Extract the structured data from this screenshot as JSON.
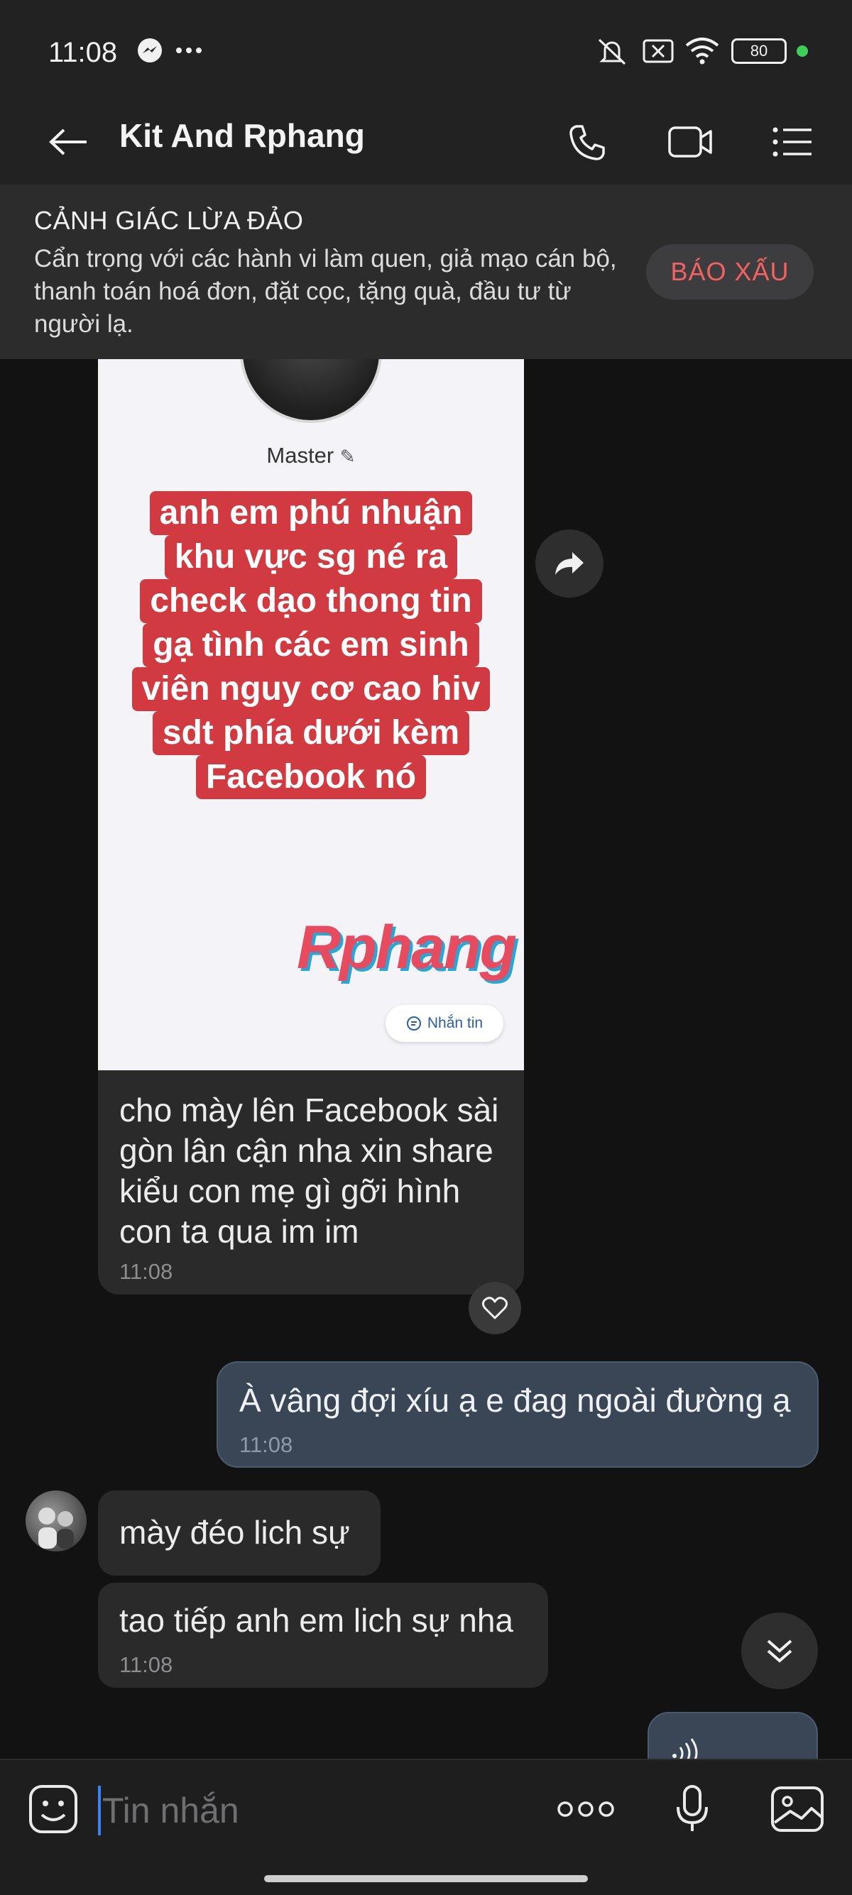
{
  "status_bar": {
    "time": "11:08",
    "battery": "80"
  },
  "header": {
    "title": "Kit And Rphang"
  },
  "warning": {
    "title": "CẢNH GIÁC LỪA ĐẢO",
    "body": "Cẩn trọng với các hành vi làm quen, giả mạo cán bộ, thanh toán hoá đơn, đặt cọc, tặng quà, đầu tư từ người lạ.",
    "report_label": "BÁO XẤU"
  },
  "messages": {
    "image_card": {
      "profile_name": "Master",
      "red_text": [
        "anh em phú nhuận",
        "khu vực sg né ra",
        "check dạo thong tin",
        "gạ tình các em sinh",
        "viên nguy cơ cao hiv",
        "sdt phía dưới kèm",
        "Facebook nó"
      ],
      "watermark": "Rphang",
      "message_pill": "Nhắn tin",
      "caption": "cho mày lên Facebook sài gòn lân cận nha xin share kiểu con mẹ gì gỡi hình con ta qua im im",
      "time": "11:08"
    },
    "sent": {
      "text": "À vâng đợi xíu ạ e đag ngoài đường ạ",
      "time": "11:08"
    },
    "received_1": {
      "text": "mày đéo lich sự"
    },
    "received_2": {
      "text": "tao tiếp anh em lich sự nha",
      "time": "11:08"
    }
  },
  "input": {
    "placeholder": "Tin nhắn"
  },
  "colors": {
    "background": "#121212",
    "bar": "#222222",
    "sent_bubble": "#3a4656",
    "received_bubble": "#2a2a2b",
    "report_text": "#f26262",
    "warning_stripe": "#d13a41"
  }
}
